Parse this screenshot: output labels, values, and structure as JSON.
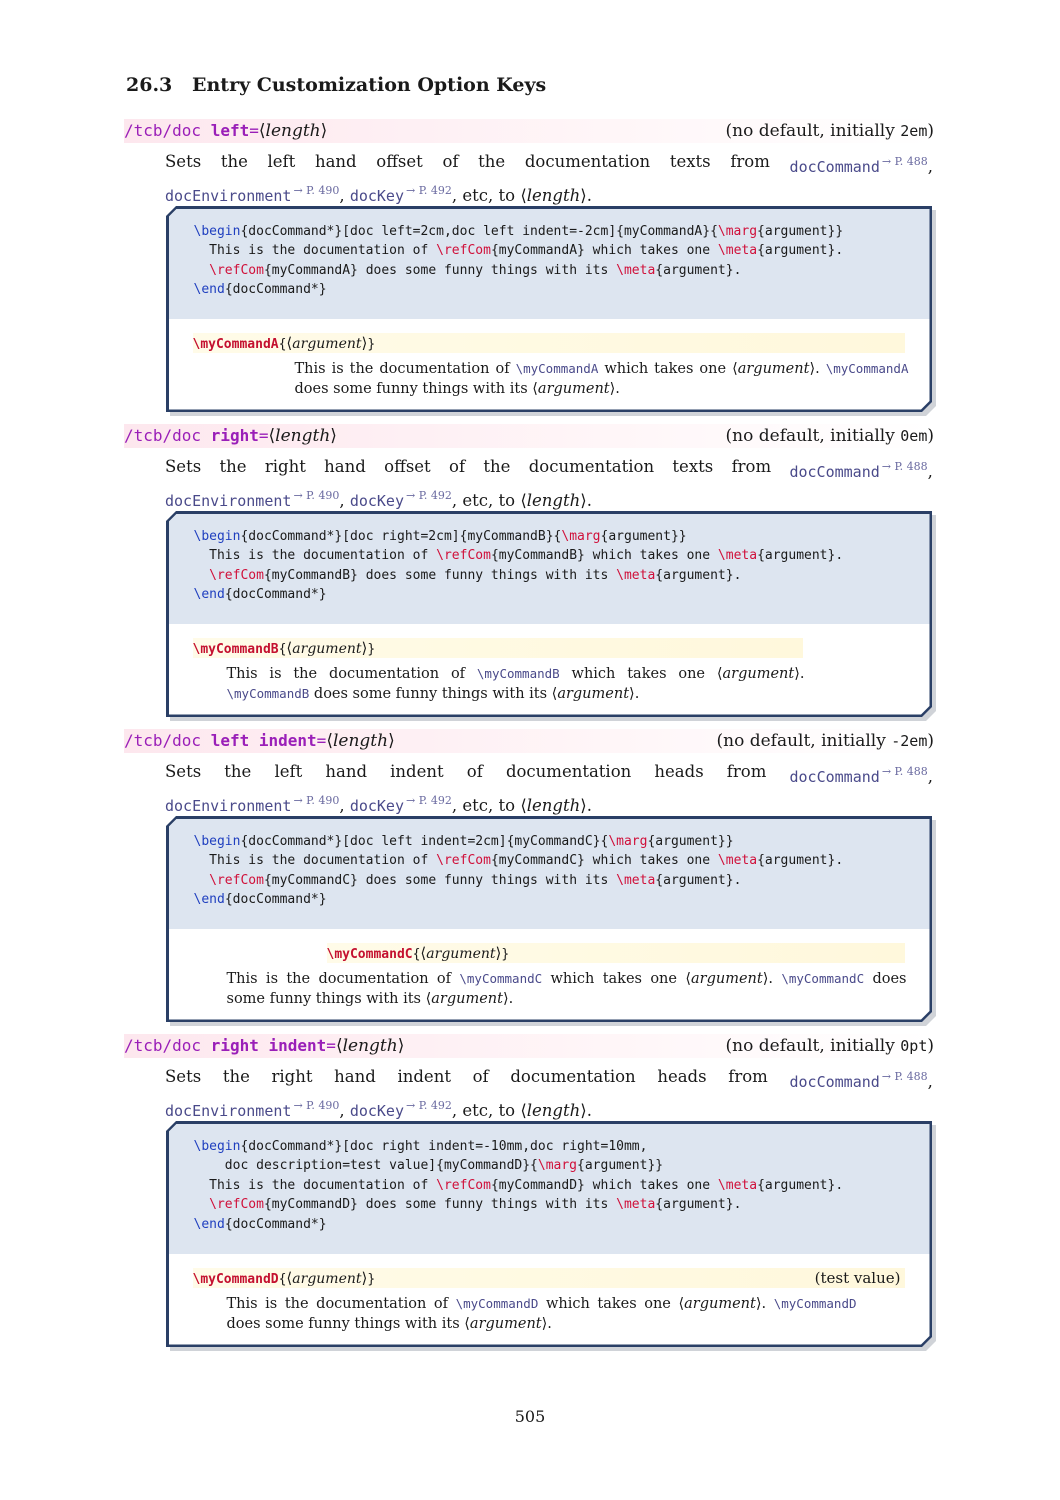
{
  "section": {
    "number": "26.3",
    "title": "Entry Customization Option Keys"
  },
  "common": {
    "eq": "=",
    "langle": "⟨",
    "rangle": "⟩",
    "length_arg": "length",
    "ref_docCommand": "docCommand",
    "ref_docCommand_page": "→ P. 488",
    "ref_docEnvironment": "docEnvironment",
    "ref_docEnvironment_page": "→ P. 490",
    "ref_docKey": "docKey",
    "ref_docKey_page": "→ P. 492",
    "tail": ", etc, to ",
    "comma": ",",
    "period": ".",
    "default_prefix": "(no default, initially ",
    "default_suffix": ")"
  },
  "keys": [
    {
      "path": "/tcb/doc ",
      "name": "left",
      "initial": "2em",
      "desc_words": [
        "Sets",
        "the",
        "left",
        "hand",
        "offset",
        "of",
        "the",
        "documentation",
        "texts",
        "from"
      ],
      "code": {
        "l1_begin": "\\begin",
        "l1_a": "{docCommand*}[doc left=2cm,doc left indent=-2cm]{myCommandA}{",
        "l1_marg": "\\marg",
        "l1_b": "{argument}}",
        "l2_a": "  This is the documentation of ",
        "l2_ref": "\\refCom",
        "l2_b": "{myCommandA} which takes one ",
        "l2_meta": "\\meta",
        "l2_c": "{argument}.",
        "l3_a": "  ",
        "l3_ref": "\\refCom",
        "l3_b": "{myCommandA} does some funny things with its ",
        "l3_meta": "\\meta",
        "l3_c": "{argument}.",
        "l4_end": "\\end",
        "l4_a": "{docCommand*}"
      },
      "result": {
        "cmd": "\\myCommandA",
        "arg": "argument",
        "text_a": "This is the documentation of ",
        "text_ref1": "\\myCommandA",
        "text_b": " which takes one ",
        "text_arg": "argument",
        "text_c": ". ",
        "text_ref2": "\\myCommandA",
        "text_d": " does some funny things with its ",
        "text_arg2": "argument",
        "text_e": "."
      }
    },
    {
      "path": "/tcb/doc ",
      "name": "right",
      "initial": "0em",
      "desc_words": [
        "Sets",
        "the",
        "right",
        "hand",
        "offset",
        "of",
        "the",
        "documentation",
        "texts",
        "from"
      ],
      "code": {
        "l1_begin": "\\begin",
        "l1_a": "{docCommand*}[doc right=2cm]{myCommandB}{",
        "l1_marg": "\\marg",
        "l1_b": "{argument}}",
        "l2_a": "  This is the documentation of ",
        "l2_ref": "\\refCom",
        "l2_b": "{myCommandB} which takes one ",
        "l2_meta": "\\meta",
        "l2_c": "{argument}.",
        "l3_a": "  ",
        "l3_ref": "\\refCom",
        "l3_b": "{myCommandB} does some funny things with its ",
        "l3_meta": "\\meta",
        "l3_c": "{argument}.",
        "l4_end": "\\end",
        "l4_a": "{docCommand*}"
      },
      "result": {
        "cmd": "\\myCommandB",
        "arg": "argument",
        "text_a": "This is the documentation of ",
        "text_ref1": "\\myCommandB",
        "text_b": " which takes one ",
        "text_arg": "argument",
        "text_c": ". ",
        "text_ref2": "\\myCommandB",
        "text_d": " does some funny things with its ",
        "text_arg2": "argument",
        "text_e": "."
      }
    },
    {
      "path": "/tcb/doc ",
      "name": "left indent",
      "initial": "-2em",
      "desc_words": [
        "Sets",
        "the",
        "left",
        "hand",
        "indent",
        "of",
        "documentation",
        "heads",
        "from"
      ],
      "code": {
        "l1_begin": "\\begin",
        "l1_a": "{docCommand*}[doc left indent=2cm]{myCommandC}{",
        "l1_marg": "\\marg",
        "l1_b": "{argument}}",
        "l2_a": "  This is the documentation of ",
        "l2_ref": "\\refCom",
        "l2_b": "{myCommandC} which takes one ",
        "l2_meta": "\\meta",
        "l2_c": "{argument}.",
        "l3_a": "  ",
        "l3_ref": "\\refCom",
        "l3_b": "{myCommandC} does some funny things with its ",
        "l3_meta": "\\meta",
        "l3_c": "{argument}.",
        "l4_end": "\\end",
        "l4_a": "{docCommand*}"
      },
      "result": {
        "cmd": "\\myCommandC",
        "arg": "argument",
        "text_a": "This is the documentation of ",
        "text_ref1": "\\myCommandC",
        "text_b": " which takes one ",
        "text_arg": "argument",
        "text_c": ". ",
        "text_ref2": "\\myCommandC",
        "text_d": " does some funny things with its ",
        "text_arg2": "argument",
        "text_e": "."
      }
    },
    {
      "path": "/tcb/doc ",
      "name": "right indent",
      "initial": "0pt",
      "desc_words": [
        "Sets",
        "the",
        "right",
        "hand",
        "indent",
        "of",
        "documentation",
        "heads",
        "from"
      ],
      "code": {
        "l1_begin": "\\begin",
        "l1_a": "{docCommand*}[doc right indent=-10mm,doc right=10mm,",
        "l1b_a": "    doc description=test value]{myCommandD}{",
        "l1_marg": "\\marg",
        "l1_b": "{argument}}",
        "l2_a": "  This is the documentation of ",
        "l2_ref": "\\refCom",
        "l2_b": "{myCommandD} which takes one ",
        "l2_meta": "\\meta",
        "l2_c": "{argument}.",
        "l3_a": "  ",
        "l3_ref": "\\refCom",
        "l3_b": "{myCommandD} does some funny things with its ",
        "l3_meta": "\\meta",
        "l3_c": "{argument}.",
        "l4_end": "\\end",
        "l4_a": "{docCommand*}"
      },
      "result": {
        "cmd": "\\myCommandD",
        "arg": "argument",
        "description": "(test value)",
        "text_a": "This is the documentation of ",
        "text_ref1": "\\myCommandD",
        "text_b": " which takes one ",
        "text_arg": "argument",
        "text_c": ". ",
        "text_ref2": "\\myCommandD",
        "text_d": " does some funny things with its ",
        "text_arg2": "argument",
        "text_e": "."
      }
    }
  ],
  "page_number": "505"
}
